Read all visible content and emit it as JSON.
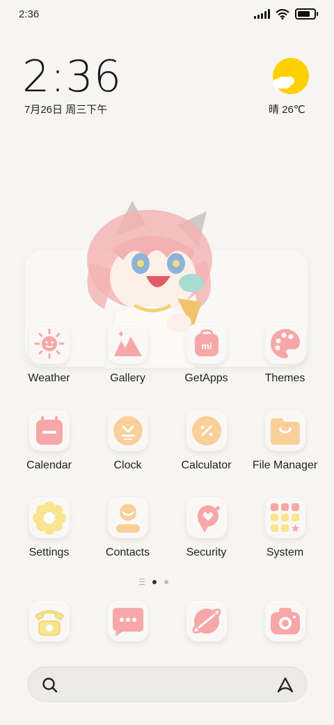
{
  "status_bar": {
    "time": "2:36",
    "battery_level": 0.85
  },
  "clock_widget": {
    "time": "2:36",
    "date": "7月26日 周三下午"
  },
  "weather_widget": {
    "text": "晴 26℃",
    "sun_color": "#ffd000"
  },
  "grid_apps": [
    {
      "label": "Weather",
      "icon": "sun-icon"
    },
    {
      "label": "Gallery",
      "icon": "mountains-icon"
    },
    {
      "label": "GetApps",
      "icon": "shopping-bag-icon"
    },
    {
      "label": "Themes",
      "icon": "palette-icon"
    },
    {
      "label": "Calendar",
      "icon": "calendar-icon"
    },
    {
      "label": "Clock",
      "icon": "clock-icon"
    },
    {
      "label": "Calculator",
      "icon": "calculator-icon"
    },
    {
      "label": "File Manager",
      "icon": "folder-icon"
    },
    {
      "label": "Settings",
      "icon": "gear-flower-icon"
    },
    {
      "label": "Contacts",
      "icon": "person-icon"
    },
    {
      "label": "Security",
      "icon": "shield-heart-icon"
    },
    {
      "label": "System",
      "icon": "app-grid-icon"
    }
  ],
  "dock_apps": [
    {
      "icon": "phone-icon"
    },
    {
      "icon": "message-icon"
    },
    {
      "icon": "browser-icon"
    },
    {
      "icon": "camera-icon"
    }
  ],
  "page_indicator": {
    "pages": 2,
    "current": 1
  },
  "colors": {
    "pink": "#f7a7a8",
    "peach": "#fbcf9a",
    "yellow": "#f9e58f",
    "background": "#f6f5f3"
  }
}
